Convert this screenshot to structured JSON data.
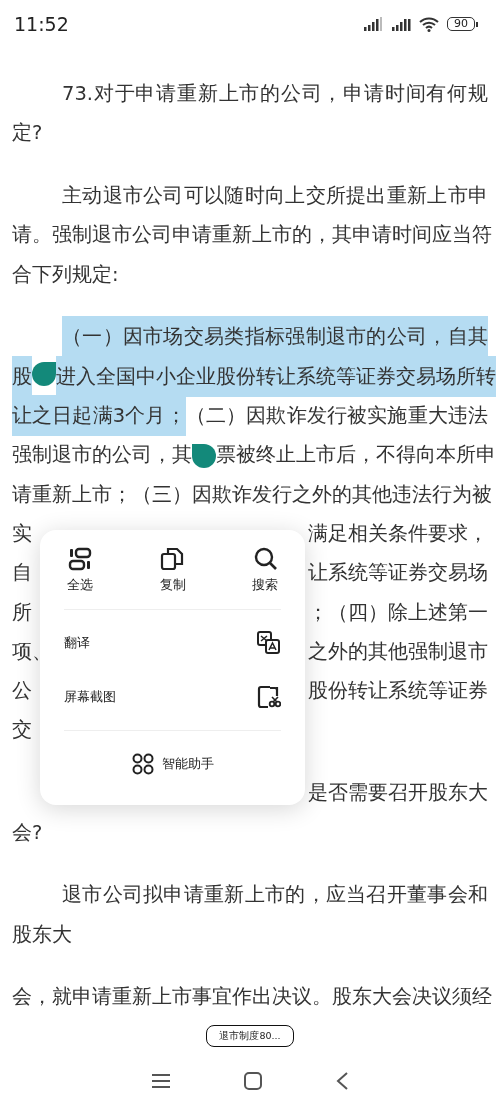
{
  "status_bar": {
    "time": "11:52",
    "battery": "90"
  },
  "article": {
    "paragraphs": [
      {
        "lines": [
          {
            "kind": "text",
            "segments": [
              {
                "text": "73.对于申请重新上市的公司，申请时间有何规",
                "selected": false
              }
            ]
          },
          {
            "kind": "text",
            "segments": [
              {
                "text": "定?",
                "selected": false
              }
            ]
          }
        ]
      },
      {
        "lines": [
          {
            "kind": "text",
            "segments": [
              {
                "text": "主动退市公司可以随时向上交所提出重新上市申",
                "selected": false
              }
            ]
          },
          {
            "kind": "text",
            "segments": [
              {
                "text": "请。强制退市公司申请重新上市的，其申请时间应当符",
                "selected": false
              }
            ]
          },
          {
            "kind": "text",
            "segments": [
              {
                "text": "合下列规定:",
                "selected": false
              }
            ]
          }
        ]
      },
      {
        "lines": [
          {
            "kind": "text",
            "segments": [
              {
                "text": "（一）因市场交易类指标强制退市的公司，自其",
                "selected": true
              }
            ]
          },
          {
            "kind": "text",
            "segments": [
              {
                "text": "股",
                "selected": true
              },
              {
                "kind": "handle"
              },
              {
                "text": "进入全国中小企业股份转让系统等证券交易场所转",
                "selected": true
              }
            ]
          },
          {
            "kind": "text",
            "segments": [
              {
                "text": "让之日起满3个月；",
                "selected": true
              },
              {
                "text": "（二）因欺诈发行被实施重大违法",
                "selected": false
              }
            ]
          },
          {
            "kind": "text",
            "segments": [
              {
                "text": "强制退市的公司，其",
                "selected": false
              },
              {
                "kind": "handle"
              },
              {
                "text": "票被终止上市后，不得向本所申",
                "selected": false
              }
            ]
          },
          {
            "kind": "text",
            "segments": [
              {
                "text": "请重新上市；（三）因欺诈发行之外的其他违法行为被",
                "selected": false
              }
            ]
          },
          {
            "kind": "covered",
            "left": "实",
            "right": "满足相关条件要求，"
          },
          {
            "kind": "covered",
            "left": "自",
            "right": "让系统等证券交易场"
          },
          {
            "kind": "covered",
            "left": "所",
            "right": "；（四）除上述第一"
          },
          {
            "kind": "covered",
            "left": "项、",
            "right": "之外的其他强制退市"
          },
          {
            "kind": "covered",
            "left": "公",
            "right": "股份转让系统等证券"
          },
          {
            "kind": "covered",
            "left": "交"
          }
        ]
      },
      {
        "lines": [
          {
            "kind": "covered",
            "right": "是否需要召开股东大"
          },
          {
            "kind": "text",
            "segments": [
              {
                "text": "会?",
                "selected": false
              }
            ]
          }
        ]
      },
      {
        "lines": [
          {
            "kind": "text",
            "segments": [
              {
                "text": "退市公司拟申请重新上市的，应当召开董事会和",
                "selected": false
              }
            ]
          },
          {
            "kind": "text",
            "segments": [
              {
                "text": "股东大",
                "selected": false
              }
            ]
          }
        ]
      },
      {
        "continued": true,
        "lines": [
          {
            "kind": "text",
            "segments": [
              {
                "text": "会，就申请重新上市事宜作出决议。股东大会决议须经",
                "selected": false
              }
            ]
          }
        ]
      }
    ]
  },
  "context_menu": {
    "top_actions": [
      {
        "label": "全选"
      },
      {
        "label": "复制"
      },
      {
        "label": "搜索"
      }
    ],
    "list_actions": [
      {
        "label": "翻译"
      },
      {
        "label": "屏幕截图"
      }
    ],
    "assistant": {
      "label": "智能助手"
    }
  },
  "bottom_chip": {
    "label": "退市制度80..."
  }
}
